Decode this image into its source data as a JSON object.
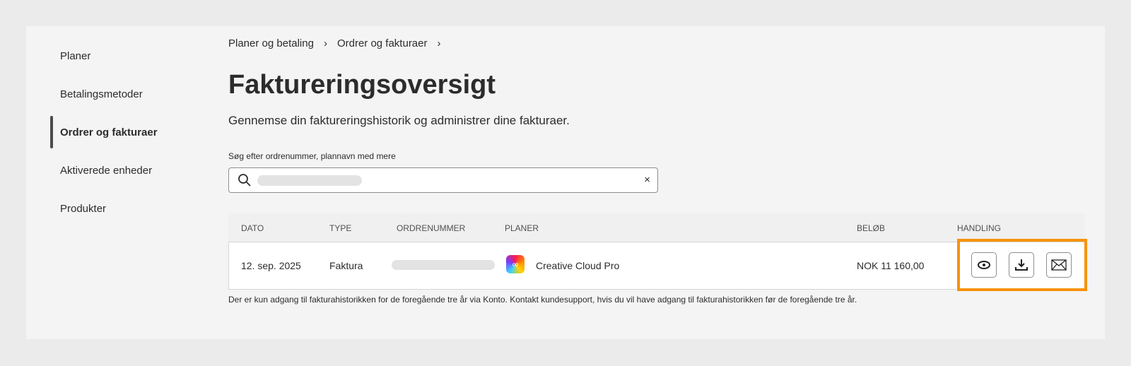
{
  "sidebar": {
    "items": [
      {
        "label": "Planer"
      },
      {
        "label": "Betalingsmetoder"
      },
      {
        "label": "Ordrer og fakturaer"
      },
      {
        "label": "Aktiverede enheder"
      },
      {
        "label": "Produkter"
      }
    ]
  },
  "breadcrumb": [
    "Planer og betaling",
    "Ordrer og fakturaer"
  ],
  "title": "Faktureringsoversigt",
  "subtitle": "Gennemse din faktureringshistorik og administrer dine fakturaer.",
  "search": {
    "label": "Søg efter ordrenummer, plannavn med mere",
    "clear": "×"
  },
  "table": {
    "headers": [
      "DATO",
      "TYPE",
      "ORDRENUMMER",
      "PLANER",
      "BELØB",
      "HANDLING"
    ],
    "rows": [
      {
        "date": "12. sep. 2025",
        "type": "Faktura",
        "plan": "Creative Cloud Pro",
        "amount": "NOK 11 160,00"
      }
    ]
  },
  "note": "Der er kun adgang til fakturahistorikken for de foregående tre år via Konto. Kontakt kundesupport, hvis du vil have adgang til fakturahistorikken før de foregående tre år.",
  "colors": {
    "highlight": "#f7930c"
  }
}
